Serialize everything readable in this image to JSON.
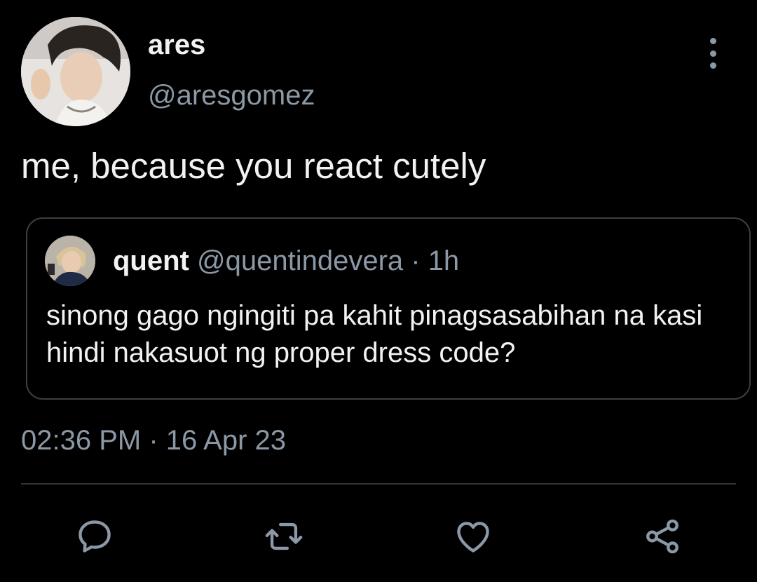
{
  "tweet": {
    "author_name": "ares",
    "author_handle": "@aresgomez",
    "text": "me, because you react cutely",
    "timestamp": "02:36 PM · 16 Apr 23",
    "quoted": {
      "name": "quent",
      "handle": "@quentindevera",
      "time": " · 1h",
      "text": "sinong gago ngingiti pa kahit pinagsasabihan na kasi hindi nakasuot ng proper dress code?"
    }
  },
  "icons": {
    "more": "more-vertical-icon",
    "reply": "reply-icon",
    "retweet": "retweet-icon",
    "like": "heart-icon",
    "share": "share-icon"
  },
  "colors": {
    "background": "#000000",
    "text": "#f2f2f2",
    "muted": "#8b98a5",
    "border": "#3a3f44"
  }
}
